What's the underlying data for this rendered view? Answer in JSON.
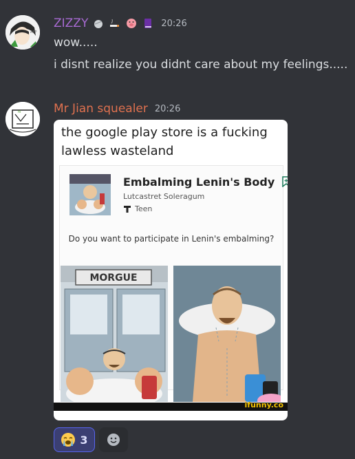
{
  "messages": [
    {
      "author": "ZIZZY",
      "author_color": "#a96bd4",
      "timestamp": "20:26",
      "lines": [
        "wow.....",
        "i disnt realize you didnt care about my feelings....."
      ],
      "badges": [
        "shell-icon",
        "cigarette-icon",
        "pig-icon",
        "book-icon"
      ]
    },
    {
      "author": "Mr Jian squealer",
      "author_color": "#e0714f",
      "timestamp": "20:26",
      "attachment": {
        "caption": "the google play store is a fucking lawless wasteland",
        "app_title": "Embalming Lenin's Body",
        "app_developer": "Lutcastret Soleragum",
        "app_rating": "Teen",
        "question": "Do you want to participate in Lenin's embalming?",
        "panel_sign": "MORGUE",
        "watermark": "ifunny.co"
      }
    }
  ],
  "reactions": [
    {
      "emoji": "crying-face-icon",
      "count": "3",
      "active": true
    },
    {
      "emoji": "add-reaction-icon",
      "count": "",
      "active": false
    }
  ]
}
